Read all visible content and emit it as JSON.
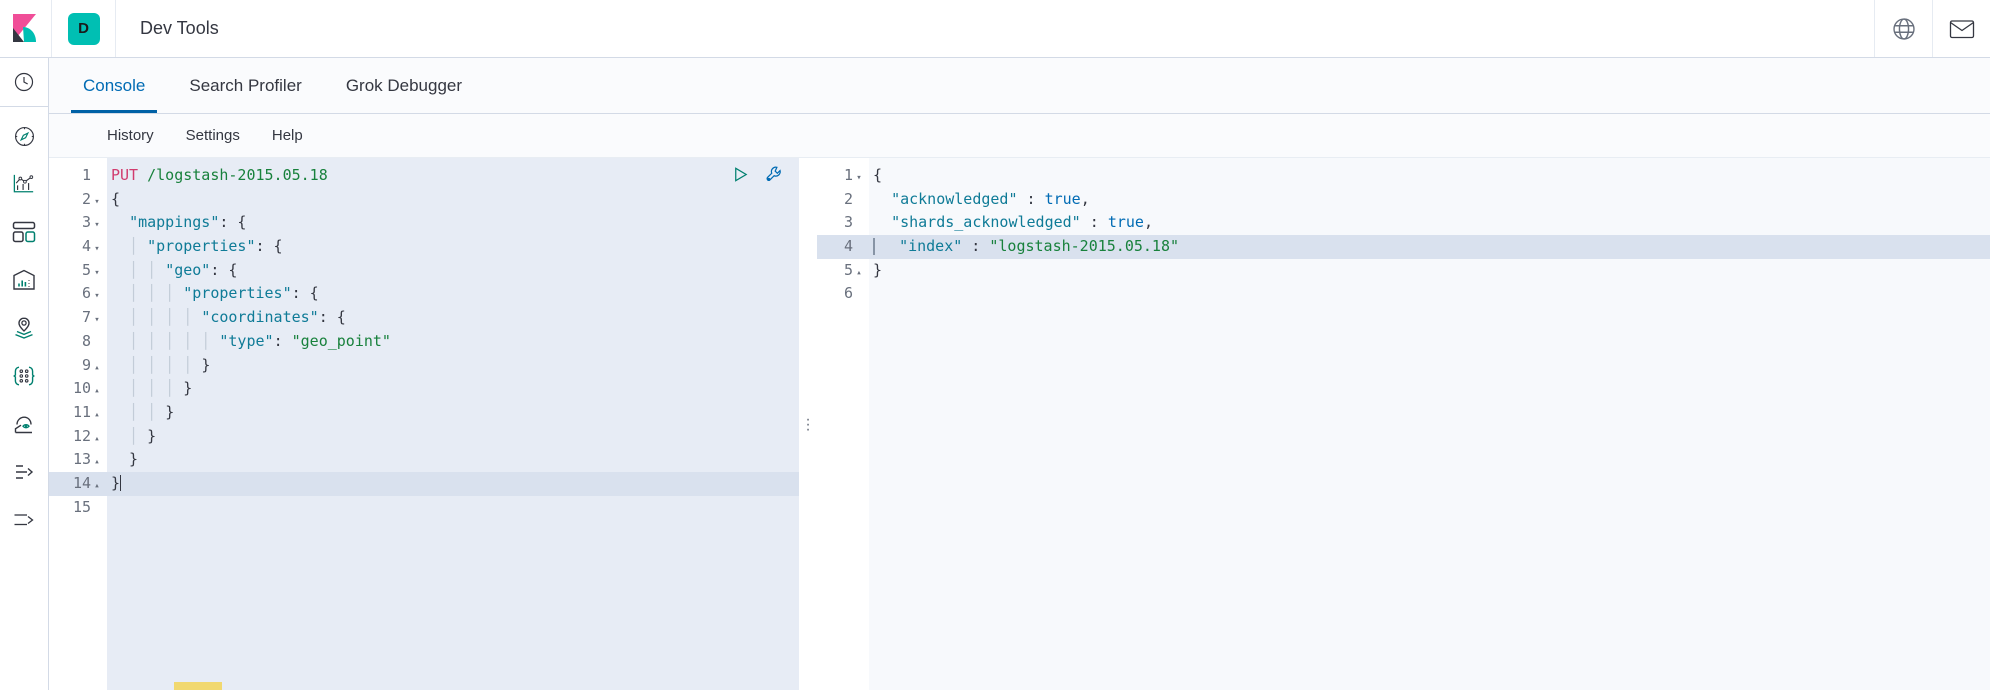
{
  "header": {
    "logo_icon": "kibana-logo-icon",
    "badge_label": "D",
    "title": "Dev Tools",
    "right_icons": [
      {
        "name": "help-globe-icon"
      },
      {
        "name": "mail-icon"
      }
    ]
  },
  "sidebar": {
    "items": [
      {
        "name": "recently-viewed-icon",
        "label": "Recently viewed"
      },
      {
        "name": "discover-compass-icon",
        "label": "Discover"
      },
      {
        "name": "visualize-chart-icon",
        "label": "Visualize"
      },
      {
        "name": "dashboard-icon",
        "label": "Dashboard"
      },
      {
        "name": "canvas-icon",
        "label": "Canvas"
      },
      {
        "name": "maps-layers-icon",
        "label": "Maps"
      },
      {
        "name": "machine-learning-icon",
        "label": "Machine Learning"
      },
      {
        "name": "infrastructure-icon",
        "label": "Infrastructure"
      },
      {
        "name": "logs-icon",
        "label": "Logs"
      },
      {
        "name": "collapse-nav-icon",
        "label": "Collapse"
      }
    ]
  },
  "tabs": [
    {
      "label": "Console",
      "active": true
    },
    {
      "label": "Search Profiler",
      "active": false
    },
    {
      "label": "Grok Debugger",
      "active": false
    }
  ],
  "menu": [
    {
      "label": "History"
    },
    {
      "label": "Settings"
    },
    {
      "label": "Help"
    }
  ],
  "editor": {
    "actions": [
      {
        "name": "send-request-play-icon",
        "label": "Click to send request"
      },
      {
        "name": "wrench-icon",
        "label": "Open documentation"
      }
    ],
    "highlighted_line": 14,
    "lines": [
      {
        "n": 1,
        "fold": "",
        "tokens": [
          {
            "t": "method",
            "v": "PUT"
          },
          {
            "t": "punct",
            "v": " "
          },
          {
            "t": "url",
            "v": "/logstash-2015.05.18"
          }
        ]
      },
      {
        "n": 2,
        "fold": "▾",
        "tokens": [
          {
            "t": "punct",
            "v": "{"
          }
        ]
      },
      {
        "n": 3,
        "fold": "▾",
        "tokens": [
          {
            "t": "punct",
            "v": "  "
          },
          {
            "t": "key",
            "v": "\"mappings\""
          },
          {
            "t": "punct",
            "v": ": {"
          }
        ]
      },
      {
        "n": 4,
        "fold": "▾",
        "tokens": [
          {
            "t": "guide",
            "v": "  │ "
          },
          {
            "t": "key",
            "v": "\"properties\""
          },
          {
            "t": "punct",
            "v": ": {"
          }
        ]
      },
      {
        "n": 5,
        "fold": "▾",
        "tokens": [
          {
            "t": "guide",
            "v": "  │ │ "
          },
          {
            "t": "key",
            "v": "\"geo\""
          },
          {
            "t": "punct",
            "v": ": {"
          }
        ]
      },
      {
        "n": 6,
        "fold": "▾",
        "tokens": [
          {
            "t": "guide",
            "v": "  │ │ │ "
          },
          {
            "t": "key",
            "v": "\"properties\""
          },
          {
            "t": "punct",
            "v": ": {"
          }
        ]
      },
      {
        "n": 7,
        "fold": "▾",
        "tokens": [
          {
            "t": "guide",
            "v": "  │ │ │ │ "
          },
          {
            "t": "key",
            "v": "\"coordinates\""
          },
          {
            "t": "punct",
            "v": ": {"
          }
        ]
      },
      {
        "n": 8,
        "fold": "",
        "tokens": [
          {
            "t": "guide",
            "v": "  │ │ │ │ │ "
          },
          {
            "t": "key",
            "v": "\"type\""
          },
          {
            "t": "punct",
            "v": ": "
          },
          {
            "t": "str",
            "v": "\"geo_point\""
          }
        ]
      },
      {
        "n": 9,
        "fold": "▴",
        "tokens": [
          {
            "t": "guide",
            "v": "  │ │ │ │ "
          },
          {
            "t": "punct",
            "v": "}"
          }
        ]
      },
      {
        "n": 10,
        "fold": "▴",
        "tokens": [
          {
            "t": "guide",
            "v": "  │ │ │ "
          },
          {
            "t": "punct",
            "v": "}"
          }
        ]
      },
      {
        "n": 11,
        "fold": "▴",
        "tokens": [
          {
            "t": "guide",
            "v": "  │ │ "
          },
          {
            "t": "punct",
            "v": "}"
          }
        ]
      },
      {
        "n": 12,
        "fold": "▴",
        "tokens": [
          {
            "t": "guide",
            "v": "  │ "
          },
          {
            "t": "punct",
            "v": "}"
          }
        ]
      },
      {
        "n": 13,
        "fold": "▴",
        "tokens": [
          {
            "t": "punct",
            "v": "  }"
          }
        ]
      },
      {
        "n": 14,
        "fold": "▴",
        "tokens": [
          {
            "t": "punct",
            "v": "}"
          }
        ]
      },
      {
        "n": 15,
        "fold": "",
        "tokens": []
      }
    ]
  },
  "response": {
    "highlighted_line": 4,
    "lines": [
      {
        "n": 1,
        "fold": "▾",
        "tokens": [
          {
            "t": "punct",
            "v": "{"
          }
        ]
      },
      {
        "n": 2,
        "fold": "",
        "tokens": [
          {
            "t": "punct",
            "v": "  "
          },
          {
            "t": "key",
            "v": "\"acknowledged\""
          },
          {
            "t": "punct",
            "v": " : "
          },
          {
            "t": "bool",
            "v": "true"
          },
          {
            "t": "punct",
            "v": ","
          }
        ]
      },
      {
        "n": 3,
        "fold": "",
        "tokens": [
          {
            "t": "punct",
            "v": "  "
          },
          {
            "t": "key",
            "v": "\"shards_acknowledged\""
          },
          {
            "t": "punct",
            "v": " : "
          },
          {
            "t": "bool",
            "v": "true"
          },
          {
            "t": "punct",
            "v": ","
          }
        ]
      },
      {
        "n": 4,
        "fold": "",
        "tokens": [
          {
            "t": "punct",
            "v": "  "
          },
          {
            "t": "key",
            "v": "\"index\""
          },
          {
            "t": "punct",
            "v": " : "
          },
          {
            "t": "str",
            "v": "\"logstash-2015.05.18\""
          }
        ]
      },
      {
        "n": 5,
        "fold": "▴",
        "tokens": [
          {
            "t": "punct",
            "v": "}"
          }
        ]
      },
      {
        "n": 6,
        "fold": "",
        "tokens": []
      }
    ]
  },
  "colors": {
    "accent_blue": "#006BB4",
    "teal": "#00BFB3",
    "pink": "#F04E98",
    "method": "#d13b6e",
    "string": "#18813c",
    "key": "#0f7b97",
    "bool": "#006bb4",
    "highlight": "#d9e1ee",
    "editor_bg": "#e7ecf5",
    "response_bg": "#f7f9fc"
  },
  "splitter": {
    "name": "pane-splitter-grip",
    "glyph": "⋮"
  }
}
